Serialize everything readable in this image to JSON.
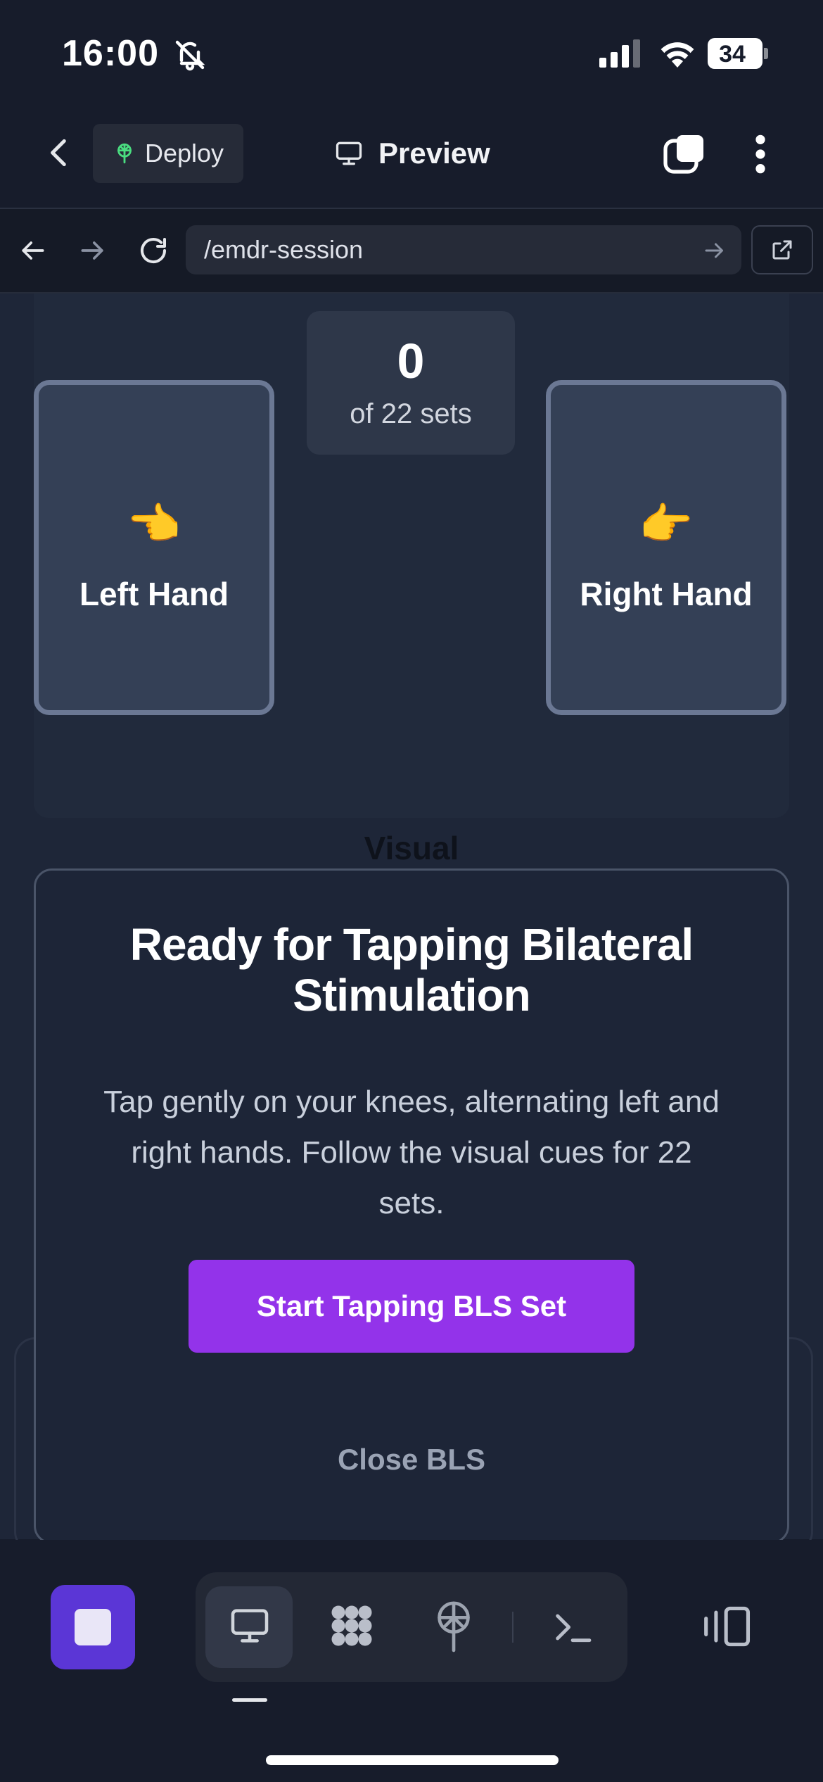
{
  "status_bar": {
    "time": "16:00",
    "battery": "34",
    "icons": [
      "bell-slash-icon",
      "signal-icon",
      "wifi-icon",
      "battery-icon"
    ]
  },
  "app_header": {
    "deploy_label": "Deploy",
    "preview_label": "Preview"
  },
  "browser": {
    "url": "/emdr-session"
  },
  "session": {
    "count": "0",
    "of_sets": "of 22 sets",
    "left_hand": {
      "emoji": "👈",
      "label": "Left Hand"
    },
    "right_hand": {
      "emoji": "👉",
      "label": "Right Hand"
    },
    "visual_label": "Visual"
  },
  "modal": {
    "title": "Ready for Tapping Bilateral Stimulation",
    "description": "Tap gently on your knees, alternating left and right hands. Follow the visual cues for 22 sets.",
    "start_label": "Start Tapping BLS Set",
    "close_label": "Close BLS"
  },
  "colors": {
    "accent": "#9333ea",
    "stop": "#5b36d6",
    "background": "#171c2b"
  }
}
